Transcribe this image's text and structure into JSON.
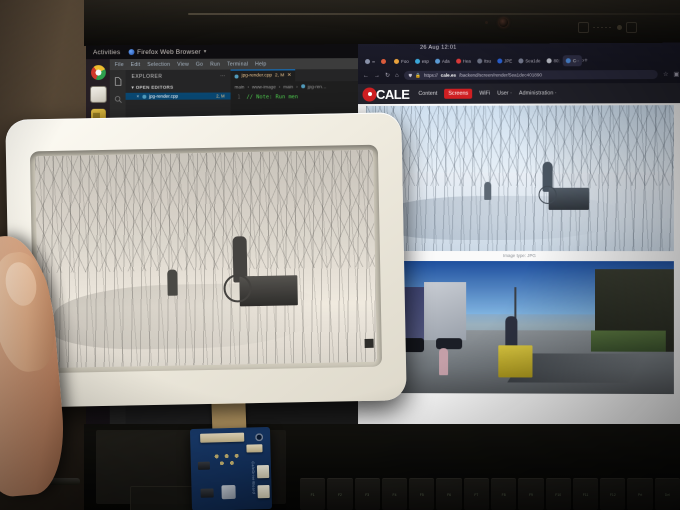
{
  "scene": {
    "description": "Hand holding a white-framed e-paper display showing a grayscale photo, in front of a laptop screen running Ubuntu with VS Code and Firefox on the CALE backend"
  },
  "ubuntu": {
    "topbar": {
      "activities": "Activities",
      "app_menu": "Firefox Web Browser",
      "caret": "▾"
    },
    "dock": [
      {
        "name": "chrome-icon",
        "label": "Google Chrome"
      },
      {
        "name": "files-icon",
        "label": "Files"
      },
      {
        "name": "folder-icon",
        "label": "Folder"
      }
    ]
  },
  "vscode": {
    "menu": [
      "File",
      "Edit",
      "Selection",
      "View",
      "Go",
      "Run",
      "Terminal",
      "Help"
    ],
    "sidebar": {
      "title": "EXPLORER",
      "more": "⋯",
      "section": "OPEN EDITORS",
      "open_editor": {
        "close": "×",
        "filename": "jpg-render.cpp",
        "path": "main/...",
        "dirty": "2, M"
      }
    },
    "tab": {
      "filename": "jpg-render.cpp",
      "dirty": "2, M",
      "close": "✕"
    },
    "breadcrumb": [
      "main",
      "www-image",
      "main",
      "jpg-ren…"
    ],
    "breadcrumb_sep": "›",
    "code": [
      {
        "line": "1",
        "text": "// Note: Run men"
      }
    ]
  },
  "firefox": {
    "clock": "26 Aug 12:01",
    "tabs": [
      {
        "label": "∞",
        "color": "#8890a8",
        "active": false
      },
      {
        "label": "",
        "color": "#d95b3c",
        "active": false
      },
      {
        "label": "Foo",
        "color": "#e8a13c",
        "active": false
      },
      {
        "label": "esp",
        "color": "#3aa6d8",
        "active": false
      },
      {
        "label": "Ada",
        "color": "#5b9bd5",
        "active": false
      },
      {
        "label": "Hea",
        "color": "#e03b3b",
        "active": false
      },
      {
        "label": "Itsu",
        "color": "#6f7487",
        "active": false
      },
      {
        "label": "JPE",
        "color": "#2b63d8",
        "active": false
      },
      {
        "label": "Sea1de",
        "color": "#7b8096",
        "active": false
      },
      {
        "label": "80:",
        "color": "#c9ccd6",
        "active": false
      },
      {
        "label": "C··",
        "color": "#4f8fe0",
        "active": true
      }
    ],
    "tab_overflow": "›",
    "new_tab": "+",
    "nav": {
      "back": "←",
      "forward": "→",
      "reload": "↻",
      "home": "⌂",
      "shield": "⛊",
      "lock": "🔒",
      "bookmark": "☆",
      "account": "▣",
      "downloads": "⤓"
    },
    "url": {
      "scheme": "https://",
      "host": "cale.es",
      "path": "/backend/screen/render/5ea1dec401890"
    }
  },
  "cale": {
    "brand": "CALE",
    "nav": [
      {
        "label": "Content",
        "active": false
      },
      {
        "label": "Screens",
        "active": true
      },
      {
        "label": "WiFi",
        "active": false
      },
      {
        "label": "User ·",
        "active": false
      },
      {
        "label": "Administration ·",
        "active": false
      }
    ],
    "accent": "#cf1f22",
    "preview": {
      "image_one_caption": "Image type: JPG",
      "image_one_alt": "Snowy forest path with an adult pushing a cart and a small child walking",
      "image_two_alt": "City street with an adult pushing a yellow cart and a small child"
    }
  },
  "epaper": {
    "frame_color": "#f6f2e7",
    "panel_alt": "Grayscale rendering of the snowy forest path photo on the e-ink panel"
  },
  "hardware": {
    "pcb_label": "CaleDriverBoard",
    "ribbon_alt": "FPC ribbon cable from e-paper panel to driver board"
  },
  "keyboard": {
    "keys": [
      "F1",
      "F2",
      "F3",
      "F4",
      "F5",
      "F6",
      "F7",
      "F8",
      "F9",
      "F10",
      "F11",
      "F12",
      "Prt",
      "Del"
    ]
  }
}
